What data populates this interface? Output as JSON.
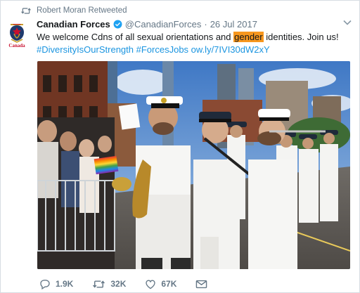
{
  "retweet": {
    "label": "Robert Moran Retweeted"
  },
  "avatar": {
    "wordmark": "Canada"
  },
  "tweet": {
    "display_name": "Canadian Forces",
    "handle": "@CanadianForces",
    "separator": "·",
    "date": "26 Jul 2017",
    "text_before": "We welcome Cdns of all sexual orientations and ",
    "text_highlight": "gender",
    "text_after": " identities. Join us!",
    "hashtag1": "#DiversityIsOurStrength",
    "hashtag2": "#ForcesJobs",
    "link": "ow.ly/7IVI30dW2xY"
  },
  "actions": {
    "reply_count": "1.9K",
    "retweet_count": "32K",
    "like_count": "67K"
  },
  "colors": {
    "link": "#1b95e0",
    "highlight": "#f7971e",
    "muted": "#657786",
    "verified": "#1da1f2"
  }
}
